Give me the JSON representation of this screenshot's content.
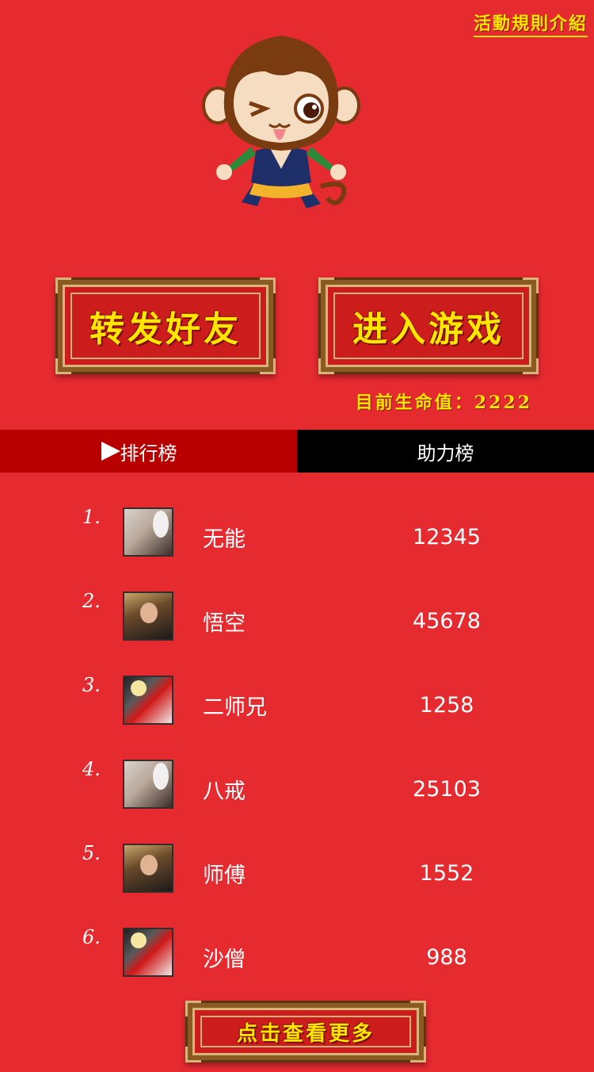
{
  "header": {
    "rules_link": "活動規則介紹"
  },
  "buttons": {
    "share": "转发好友",
    "enter_game": "进入游戏",
    "view_more": "点击查看更多"
  },
  "life": {
    "label": "目前生命值：2222"
  },
  "tabs": {
    "ranking": "排行榜",
    "helpers": "助力榜"
  },
  "ranking": [
    {
      "rank": "1.",
      "name": "无能",
      "score": "12345"
    },
    {
      "rank": "2.",
      "name": "悟空",
      "score": "45678"
    },
    {
      "rank": "3.",
      "name": "二师兄",
      "score": "1258"
    },
    {
      "rank": "4.",
      "name": "八戒",
      "score": "25103"
    },
    {
      "rank": "5.",
      "name": "师傅",
      "score": "1552"
    },
    {
      "rank": "6.",
      "name": "沙僧",
      "score": "988"
    }
  ],
  "colors": {
    "background": "#e52a30",
    "gold": "#ffe600",
    "tab_active": "#b80000",
    "tab_inactive": "#000000"
  }
}
